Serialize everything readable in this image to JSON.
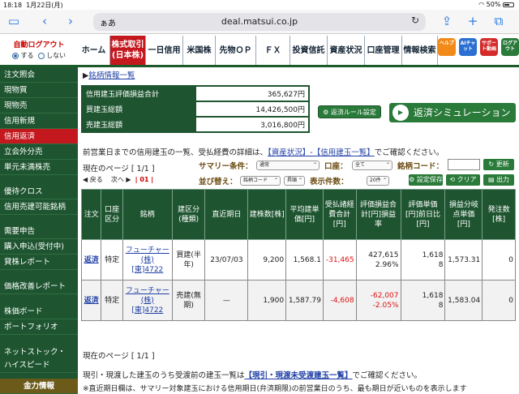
{
  "status_bar": {
    "time": "18:18",
    "date": "1月22日(月)",
    "battery": "50%"
  },
  "browser": {
    "aa": "ぁあ",
    "url": "deal.matsui.co.jp",
    "reload": "↻"
  },
  "logout": {
    "title": "自動ログアウト",
    "on_label": "する",
    "off_label": "しない"
  },
  "nav_tabs": [
    "ホーム",
    "株式取引(日本株)",
    "一日信用",
    "米国株",
    "先物ＯＰ",
    "ＦＸ",
    "投資信託",
    "資産状況",
    "口座管理",
    "情報検索"
  ],
  "app_icons": [
    {
      "label": "ヘルプ",
      "color": "#f28a1a"
    },
    {
      "label": "AIチャット",
      "color": "#2a6fd1"
    },
    {
      "label": "サポート動画",
      "color": "#d42a2a"
    },
    {
      "label": "ログアウト",
      "color": "#2a7a3a"
    }
  ],
  "sidebar": [
    {
      "label": "注文照会"
    },
    {
      "label": "現物買"
    },
    {
      "label": "現物売"
    },
    {
      "label": "信用新規"
    },
    {
      "label": "信用返済"
    },
    {
      "label": "立会外分売"
    },
    {
      "label": "単元未満株売"
    },
    {
      "label": "優待クロス"
    },
    {
      "label": "信用売建可能銘柄"
    },
    {
      "label": "需要申告"
    },
    {
      "label": "購入申込(受付中)"
    },
    {
      "label": "貸株レポート"
    },
    {
      "label": "価格改善レポート"
    },
    {
      "label": "株価ボード"
    },
    {
      "label": "ポートフォリオ"
    },
    {
      "label": "ネットストック・"
    },
    {
      "label": "ハイスピード"
    },
    {
      "label": "金力情報"
    }
  ],
  "main": {
    "stock_info_link": "銘柄情報一覧",
    "summary": [
      {
        "label": "信用建玉評価損益合計",
        "value": "365,627円"
      },
      {
        "label": "買建玉総額",
        "value": "14,426,500円"
      },
      {
        "label": "売建玉総額",
        "value": "3,016,800円"
      }
    ],
    "rule_button": "返済ルール設定",
    "sim_button": "返済シミュレーション",
    "sim_badge": "シミュレーション",
    "note_pre": "前営業日までの信用建玉の一覧、受払経費の詳細は、",
    "note_link": "【資産状況】-【信用建玉一覧】",
    "note_post": "でご確認ください。",
    "page_label": "現在のページ [ 1/1 ]",
    "prev": "◀ 戻る",
    "next": "次へ ▶",
    "page_sel": "| 01 |",
    "summary_cond_label": "サマリー条件：",
    "summary_cond_value": "通常",
    "account_label": "口座：",
    "account_value": "全て",
    "code_label": "銘柄コード：",
    "code_value": "",
    "update_btn": "更新",
    "sort_label": "並び替え：",
    "sort_key": "銘柄コード",
    "sort_order": "昇順",
    "count_label": "表示件数：",
    "count_value": "20件",
    "save_btn": "設定保存",
    "clear_btn": "クリア",
    "print_btn": "出力",
    "table_headers": [
      "注文",
      "口座区分",
      "銘柄",
      "建区分(種類)",
      "直近期日",
      "建株数[株]",
      "平均建単価[円]",
      "受払諸経費合計[円]",
      "評価損益合計[円]損益率",
      "評価単価[円]前日比[円]",
      "損益分岐点単価[円]",
      "発注数[株]"
    ],
    "rows": [
      {
        "order": "返済",
        "account": "特定",
        "name": "フューチャー(株)",
        "market": "[東]4722",
        "type": "買建(半年)",
        "expiry": "23/07/03",
        "qty": "9,200",
        "avg": "1,568.1",
        "cost": "-31,465",
        "pl": "427,615",
        "pl_rate": "2.96%",
        "eval": "1,618",
        "eval_diff": "8",
        "breakeven": "1,573.31",
        "ordered": "0"
      },
      {
        "order": "返済",
        "account": "特定",
        "name": "フューチャー(株)",
        "market": "[東]4722",
        "type": "売建(無期)",
        "expiry": "—",
        "qty": "1,900",
        "avg": "1,587.79",
        "cost": "-4,608",
        "pl": "-62,007",
        "pl_rate": "-2.05%",
        "eval": "1,618",
        "eval_diff": "8",
        "breakeven": "1,583.04",
        "ordered": "0"
      }
    ],
    "page_label_bottom": "現在のページ [ 1/1 ]",
    "footer_pre": "現引・現渡した建玉のうち受渡前の建玉一覧は",
    "footer_link": "【現引・現渡未受渡建玉一覧】",
    "footer_post": "でご確認ください。",
    "footer2": "※直近期日欄は、サマリー対象建玉における信用期日(弁済期限)の前営業日のうち、最も期日が近いものを表示します"
  }
}
